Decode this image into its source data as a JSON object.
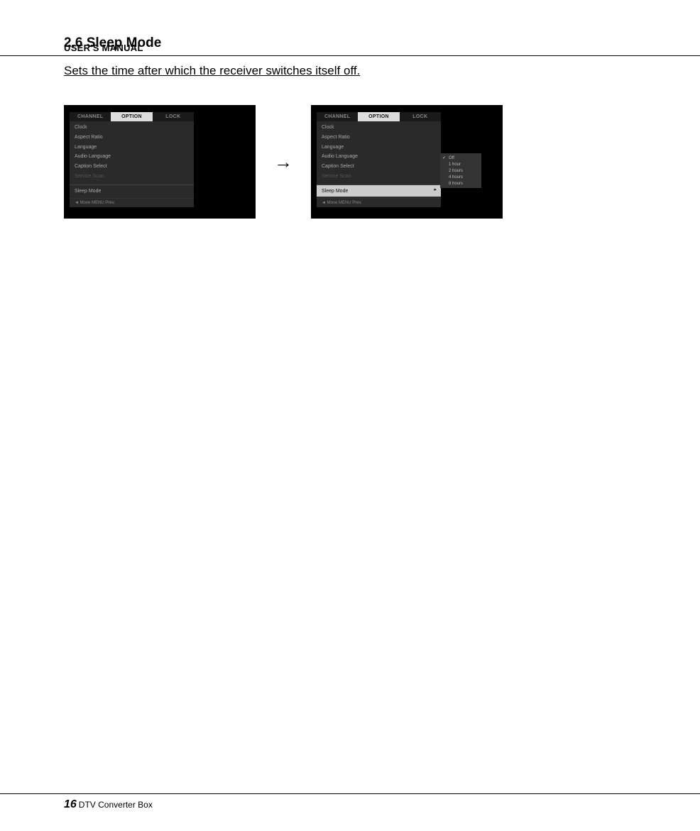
{
  "header": {
    "title": "USER'S MANUAL"
  },
  "section": {
    "number_title": "2.6 Sleep Mode",
    "description": "Sets the time after which the receiver switches itself off."
  },
  "screenshot_left": {
    "tabs": {
      "channel": "CHANNEL",
      "option": "OPTION",
      "lock": "LOCK"
    },
    "items": {
      "clock": "Clock",
      "aspect": "Aspect Ratio",
      "language": "Language",
      "audio_lang": "Audio Language",
      "caption": "Caption Select",
      "svc_scan_disabled": "Service Scan",
      "sleep_mode": "Sleep Mode"
    },
    "footer": "◄ Move  MENU Prev."
  },
  "screenshot_right": {
    "tabs": {
      "channel": "CHANNEL",
      "option": "OPTION",
      "lock": "LOCK"
    },
    "items": {
      "clock": "Clock",
      "aspect": "Aspect Ratio",
      "language": "Language",
      "audio_lang": "Audio Language",
      "caption": "Caption Select",
      "svc_scan_disabled": "Service Scan",
      "sleep_mode": "Sleep Mode"
    },
    "submenu": {
      "off": "Off",
      "h1": "1 hour",
      "h2": "2 hours",
      "h4": "4 hours",
      "h8": "8 hours"
    },
    "footer": "◄ Move  MENU Prev."
  },
  "footer": {
    "page": "16",
    "label": "DTV Converter Box"
  }
}
